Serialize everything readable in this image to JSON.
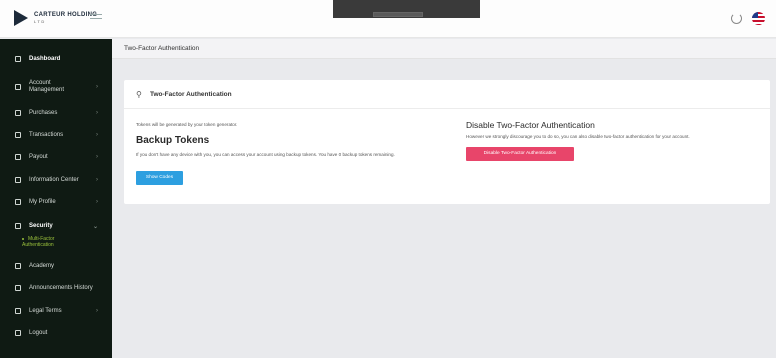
{
  "brand": {
    "name": "CARTEUR HOLDING",
    "sub": "LTD"
  },
  "sidebar": {
    "items": [
      {
        "label": "Dashboard",
        "icon": "monitor-icon"
      },
      {
        "label": "Account Management",
        "icon": "users-icon"
      },
      {
        "label": "Purchases",
        "icon": "cart-icon"
      },
      {
        "label": "Transactions",
        "icon": "card-icon"
      },
      {
        "label": "Payout",
        "icon": "wallet-icon"
      },
      {
        "label": "Information Center",
        "icon": "info-icon"
      },
      {
        "label": "My Profile",
        "icon": "user-icon"
      },
      {
        "label": "Security",
        "icon": "key-icon"
      },
      {
        "label": "Academy",
        "icon": "book-icon"
      },
      {
        "label": "Announcements History",
        "icon": "megaphone-icon"
      },
      {
        "label": "Legal Terms",
        "icon": "gavel-icon"
      },
      {
        "label": "Logout",
        "icon": "logout-icon"
      }
    ],
    "security_sub": {
      "label": "Multi-Factor Authentication"
    }
  },
  "page": {
    "title": "Two-Factor Authentication",
    "card_title": "Two-Factor Authentication",
    "tokens_note": "Tokens will be generated by your token generator.",
    "backup_title": "Backup Tokens",
    "backup_text": "If you don't have any device with you, you can access your account using backup tokens. You have 0 backup tokens remaining.",
    "show_codes_label": "Show Codes",
    "disable_title": "Disable Two-Factor Authentication",
    "disable_text": "However we strongly discourage you to do so, you can also disable two-factor authentication for your account.",
    "disable_button_label": "Disable Two-Factor Authentication"
  },
  "colors": {
    "sidebar_bg": "#0f1a13",
    "accent_green": "#9bc23c",
    "button_blue": "#2d9fe0",
    "button_pink": "#e8456a"
  }
}
